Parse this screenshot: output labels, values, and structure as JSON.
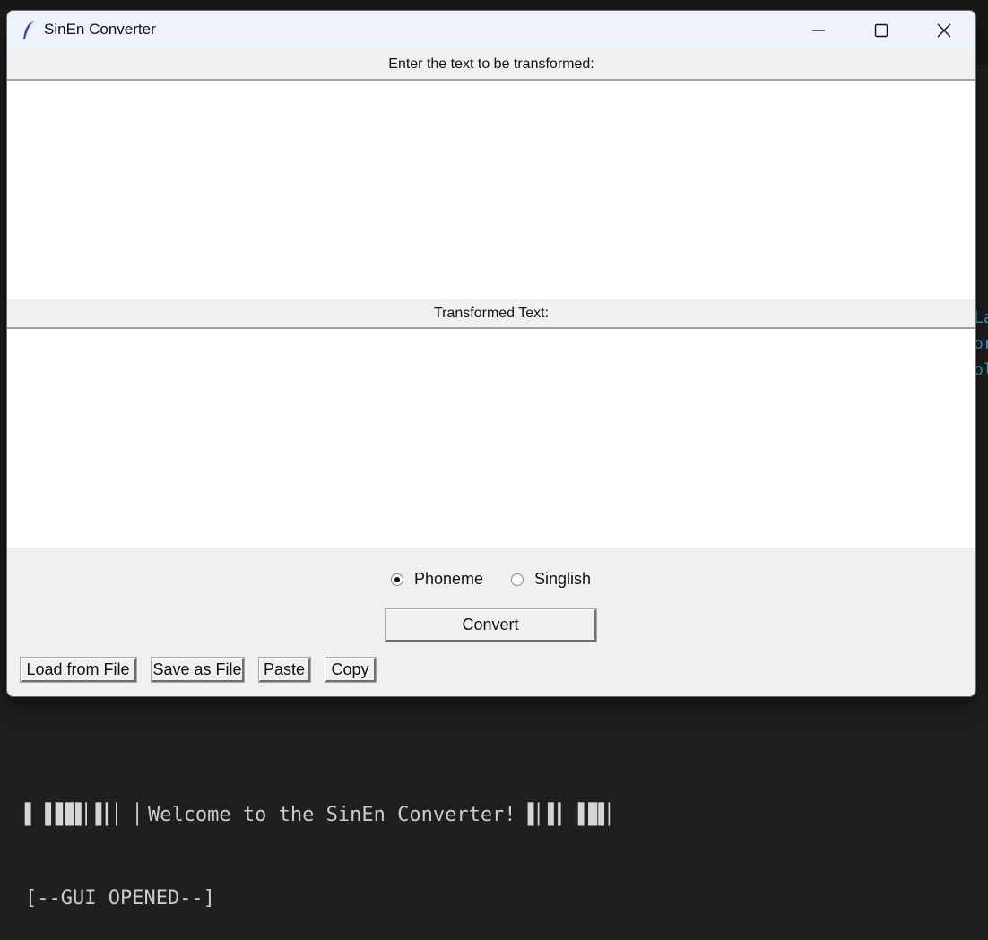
{
  "window": {
    "title": "SinEn Converter"
  },
  "input_section": {
    "label": "Enter the text to be transformed:",
    "value": ""
  },
  "output_section": {
    "label": "Transformed Text:",
    "value": ""
  },
  "mode": {
    "options": [
      "Phoneme",
      "Singlish"
    ],
    "selected": "Phoneme"
  },
  "buttons": {
    "convert": "Convert",
    "load_from_file": "Load from File",
    "save_as_file": "Save as File",
    "paste": "Paste",
    "copy": "Copy"
  },
  "terminal": {
    "bars_left": "▌▕▌▋▊▌▏▌▎▏▕",
    "welcome": "Welcome to the SinEn Converter!",
    "bars_right": "▌▏▌▎▕▌▊▌▏",
    "status": "[--GUI OPENED--]"
  },
  "background_code": [
    "La",
    "or",
    "ol"
  ],
  "colors": {
    "terminal_bg": "#1f1f1f",
    "window_bg": "#f0f0f0",
    "titlebar_bg": "#eef2fa",
    "code_accent": "#3aa7c9"
  },
  "icons": [
    "feather-icon",
    "minimize-icon",
    "maximize-icon",
    "close-icon"
  ]
}
